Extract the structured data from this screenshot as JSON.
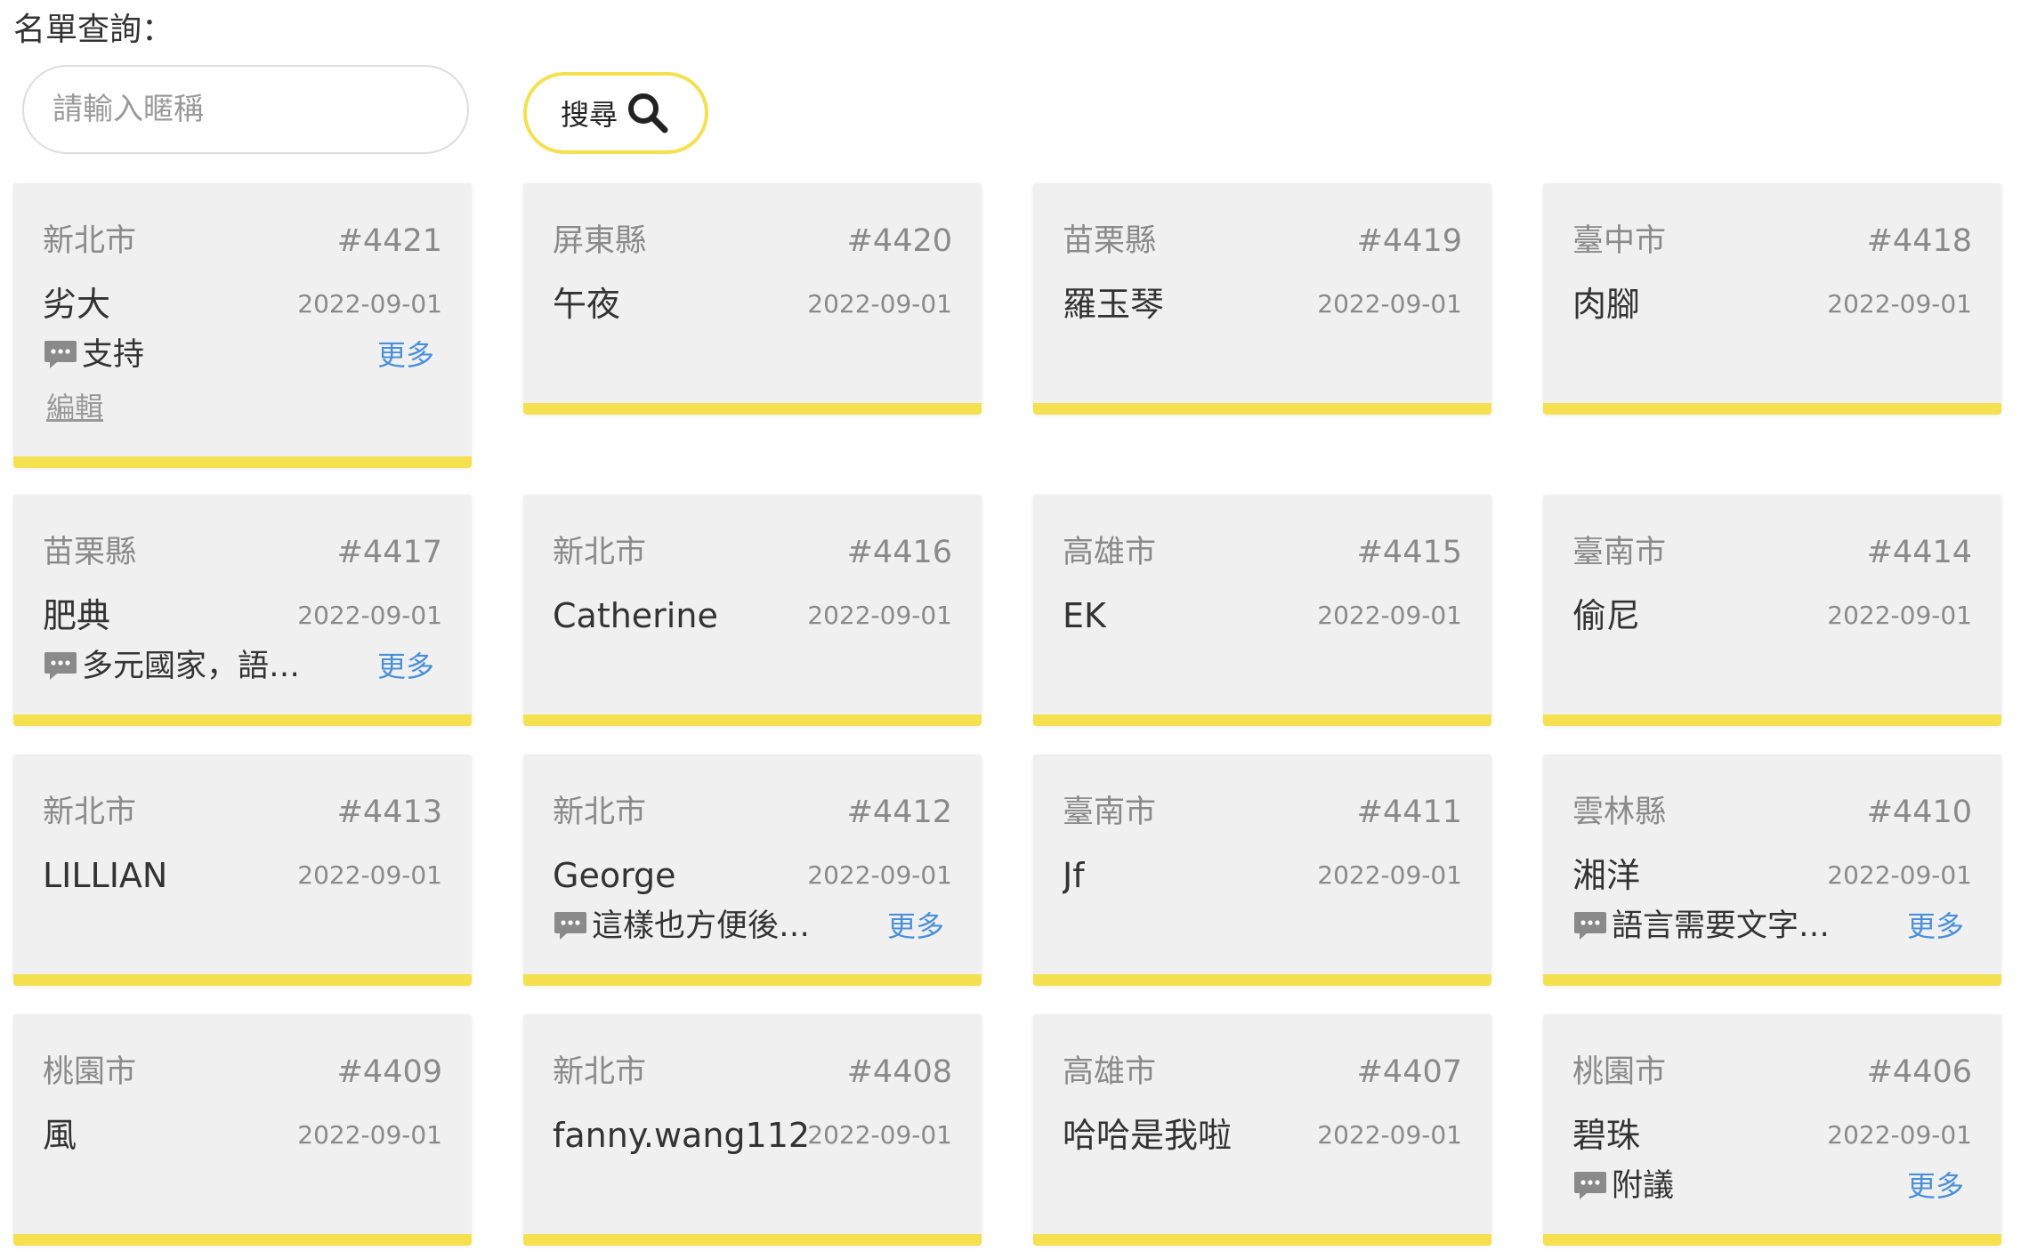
{
  "search": {
    "title": "名單查詢：",
    "placeholder": "請輸入暱稱",
    "button_label": "搜尋"
  },
  "colors": {
    "accent": "#f5e050",
    "card_bg": "#f0f0f0",
    "link": "#4a90d9",
    "muted": "#8a8a8a"
  },
  "cards": [
    {
      "region": "新北市",
      "id": "#4421",
      "name": "劣大",
      "date": "2022-09-01",
      "message": "支持",
      "more": "更多",
      "edit": "編輯"
    },
    {
      "region": "屏東縣",
      "id": "#4420",
      "name": "午夜",
      "date": "2022-09-01"
    },
    {
      "region": "苗栗縣",
      "id": "#4419",
      "name": "羅玉琴",
      "date": "2022-09-01"
    },
    {
      "region": "臺中市",
      "id": "#4418",
      "name": "肉腳",
      "date": "2022-09-01"
    },
    {
      "region": "苗栗縣",
      "id": "#4417",
      "name": "肥典",
      "date": "2022-09-01",
      "message": "多元國家，語…",
      "more": "更多"
    },
    {
      "region": "新北市",
      "id": "#4416",
      "name": "Catherine",
      "date": "2022-09-01"
    },
    {
      "region": "高雄市",
      "id": "#4415",
      "name": "EK",
      "date": "2022-09-01"
    },
    {
      "region": "臺南市",
      "id": "#4414",
      "name": "偷尼",
      "date": "2022-09-01"
    },
    {
      "region": "新北市",
      "id": "#4413",
      "name": "LILLIAN",
      "date": "2022-09-01"
    },
    {
      "region": "新北市",
      "id": "#4412",
      "name": "George",
      "date": "2022-09-01",
      "message": "這樣也方便後…",
      "more": "更多"
    },
    {
      "region": "臺南市",
      "id": "#4411",
      "name": "Jf",
      "date": "2022-09-01"
    },
    {
      "region": "雲林縣",
      "id": "#4410",
      "name": "湘洋",
      "date": "2022-09-01",
      "message": "語言需要文字…",
      "more": "更多"
    },
    {
      "region": "桃園市",
      "id": "#4409",
      "name": "風",
      "date": "2022-09-01"
    },
    {
      "region": "新北市",
      "id": "#4408",
      "name": "fanny.wang112",
      "date": "2022-09-01"
    },
    {
      "region": "高雄市",
      "id": "#4407",
      "name": "哈哈是我啦",
      "date": "2022-09-01"
    },
    {
      "region": "桃園市",
      "id": "#4406",
      "name": "碧珠",
      "date": "2022-09-01",
      "message": "附議",
      "more": "更多"
    }
  ]
}
